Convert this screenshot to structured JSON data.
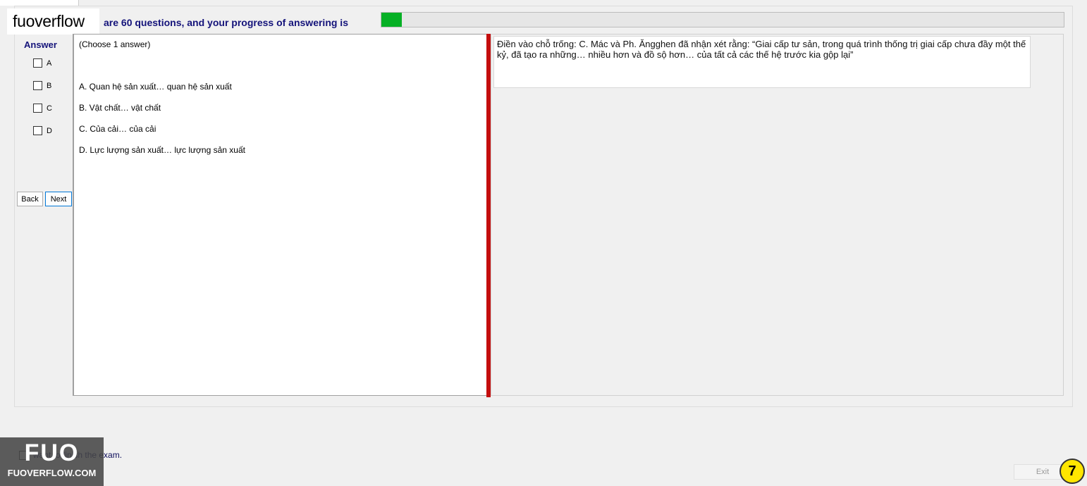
{
  "header": {
    "watermark_label": "fuoverflow",
    "progress_text": "are 60 questions, and your progress of answering is",
    "progress_fraction": 0.03
  },
  "answer_panel": {
    "title": "Answer",
    "options": [
      "A",
      "B",
      "C",
      "D"
    ],
    "back_label": "Back",
    "next_label": "Next"
  },
  "question_panel": {
    "hint": "(Choose 1 answer)",
    "options": [
      "A.  Quan hệ sản xuất… quan hệ sản xuất",
      "B.  Vật chất… vật chất",
      "C.  Của cải… của cải",
      "D.  Lực lượng sản xuất… lực lượng sản xuất"
    ]
  },
  "question_text": "Điền vào chỗ trống: C. Mác và Ph. Ăngghen đã nhận xét rằng: “Giai cấp tư sản, trong quá trình thống trị giai cấp chưa đầy một thế kỷ, đã tạo ra những… nhiều hơn và đồ sộ hơn… của tất cả các thế hệ trước kia gộp lại”",
  "footer": {
    "finish_label": "want to finish the exam.",
    "logo_mark": "FUO",
    "logo_text": "FUOVERFLOW.COM",
    "exit_label": "Exit",
    "page_number": "7"
  },
  "colors": {
    "progress_fill": "#06b025",
    "splitter": "#c40e0e",
    "label_blue": "#14137a",
    "badge_yellow": "#ffe600"
  }
}
